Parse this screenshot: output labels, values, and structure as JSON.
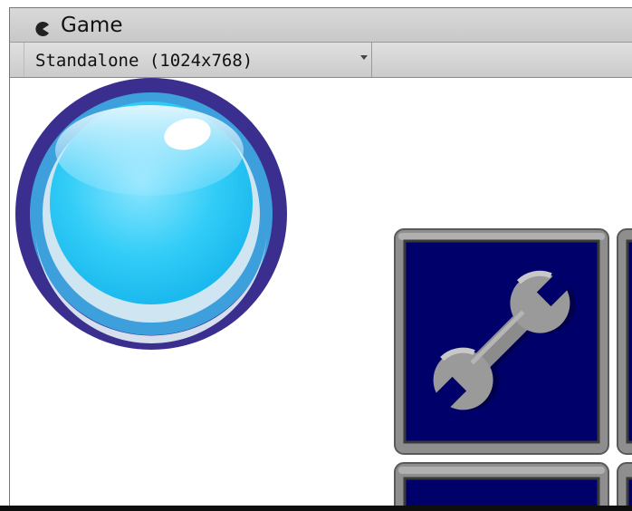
{
  "tab": {
    "title": "Game",
    "icon": "game-pacman-icon"
  },
  "toolbar": {
    "resolution_label": "Standalone (1024x768)",
    "dropdown_icon": "chevron-down-icon"
  },
  "game_view": {
    "orb": {
      "icon": "blue-glass-orb-icon",
      "ring_color": "#3a2f8f",
      "fill_color": "#27c8f5"
    },
    "tiles": [
      {
        "icon": "wrench-icon",
        "bg_color": "#00006b",
        "frame_color": "#8e8e8e"
      },
      {
        "icon": "tile-partial-icon"
      },
      {
        "icon": "tile-partial-icon"
      },
      {
        "icon": "tile-partial-icon"
      }
    ]
  }
}
